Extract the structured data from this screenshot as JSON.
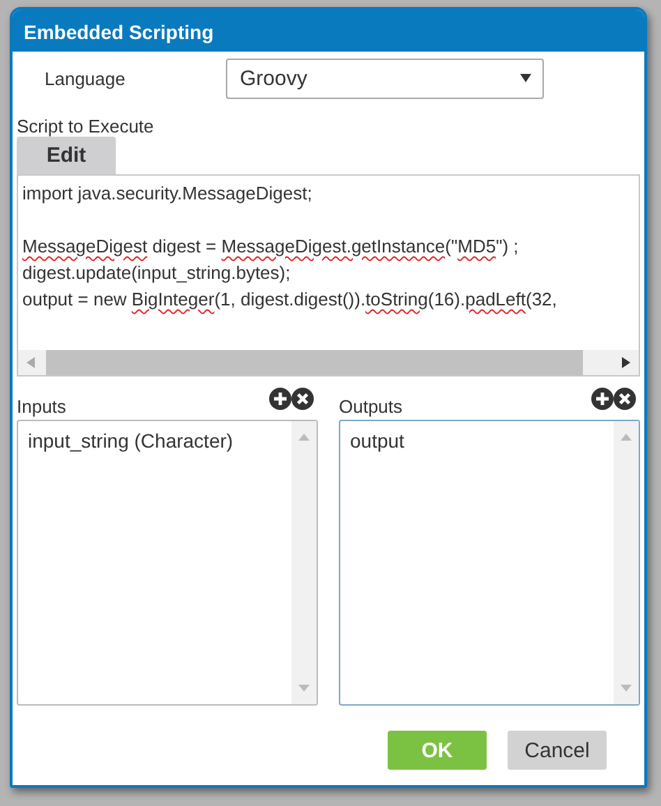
{
  "window": {
    "title": "Embedded Scripting"
  },
  "language": {
    "label": "Language",
    "value": "Groovy"
  },
  "script": {
    "label": "Script to Execute",
    "tab": "Edit",
    "lines": [
      {
        "kind": "code",
        "segments": [
          {
            "text": "import java.security.MessageDigest;",
            "misspelled": false
          }
        ]
      },
      {
        "kind": "blank"
      },
      {
        "kind": "code",
        "segments": [
          {
            "text": "MessageDigest",
            "misspelled": true
          },
          {
            "text": " digest = ",
            "misspelled": false
          },
          {
            "text": "MessageDigest.getInstance",
            "misspelled": true
          },
          {
            "text": "(\"",
            "misspelled": false
          },
          {
            "text": "MD5",
            "misspelled": true
          },
          {
            "text": "\") ;",
            "misspelled": false
          }
        ]
      },
      {
        "kind": "code",
        "segments": [
          {
            "text": "digest.update(input_string.bytes);",
            "misspelled": false
          }
        ]
      },
      {
        "kind": "code",
        "segments": [
          {
            "text": "output = new ",
            "misspelled": false
          },
          {
            "text": "BigInteger",
            "misspelled": true
          },
          {
            "text": "(1, digest.digest()).",
            "misspelled": false
          },
          {
            "text": "toString",
            "misspelled": true
          },
          {
            "text": "(16).",
            "misspelled": false
          },
          {
            "text": "padLeft",
            "misspelled": true
          },
          {
            "text": "(32, ",
            "misspelled": false
          }
        ]
      }
    ]
  },
  "inputs": {
    "label": "Inputs",
    "items": [
      "input_string (Character)"
    ]
  },
  "outputs": {
    "label": "Outputs",
    "items": [
      "output"
    ]
  },
  "buttons": [
    {
      "label": "OK",
      "kind": "primary"
    },
    {
      "label": "Cancel",
      "kind": "secondary"
    }
  ]
}
